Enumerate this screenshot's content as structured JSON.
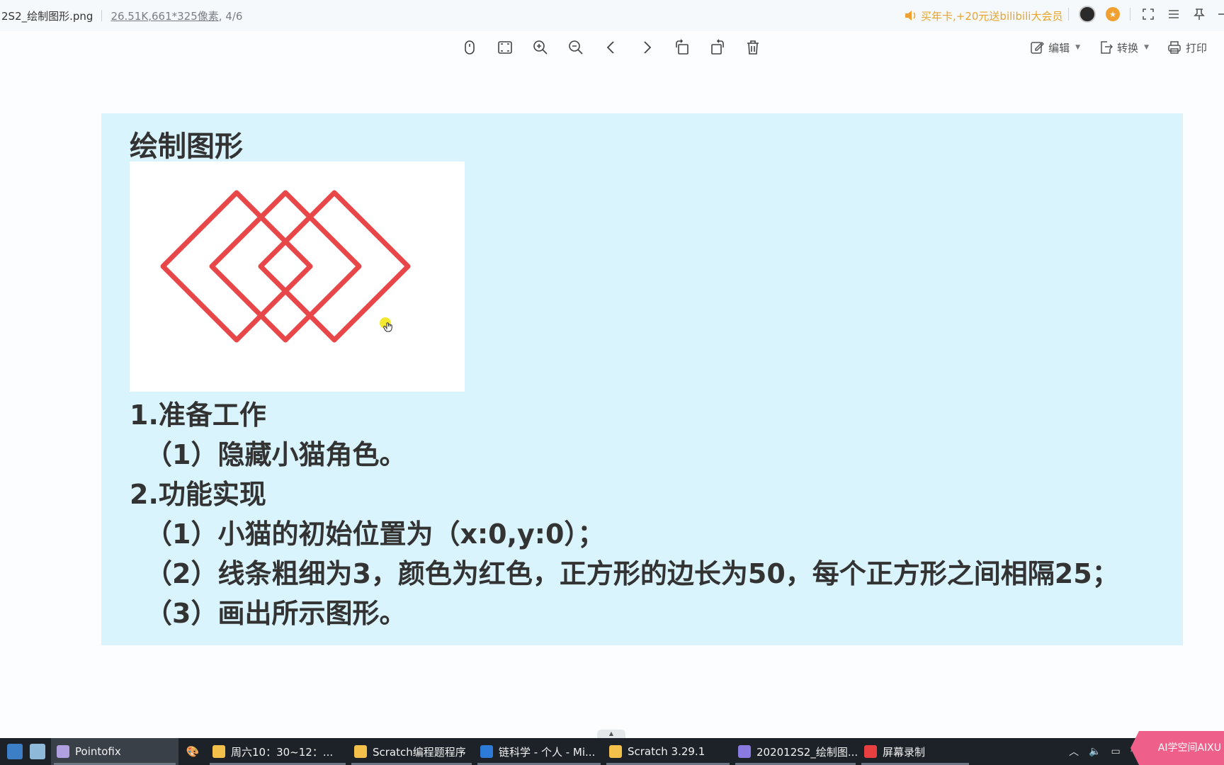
{
  "titlebar": {
    "filename": "2S2_绘制图形.png",
    "filesize": "26.51K",
    "dimensions": ",661*325像素",
    "page_index": ", 4/6",
    "promo": "买年卡,+20元送bilibili大会员"
  },
  "toolbar": {
    "tools": [
      "mouse-icon",
      "fit-screen-icon",
      "zoom-in-icon",
      "zoom-out-icon",
      "previous-icon",
      "next-icon",
      "rotate-left-icon",
      "rotate-right-icon",
      "delete-icon"
    ],
    "edit_label": "编辑",
    "convert_label": "转换",
    "print_label": "打印"
  },
  "document": {
    "title": "绘制图形",
    "lines": [
      {
        "text": "1.准备工作",
        "indent": false
      },
      {
        "text": "（1）隐藏小猫角色。",
        "indent": true
      },
      {
        "text": "2.功能实现",
        "indent": false
      },
      {
        "text": "（1）小猫的初始位置为（x:0,y:0）；",
        "indent": true
      },
      {
        "text": "（2）线条粗细为3，颜色为红色，正方形的边长为50，每个正方形之间相隔25；",
        "indent": true
      },
      {
        "text": "（3）画出所示图形。",
        "indent": true
      }
    ],
    "figure": {
      "shape_count": 3,
      "stroke_color": "#e8474a",
      "side_length": 50,
      "spacing": 25
    },
    "background_color": "#d9f4fc"
  },
  "taskbar": {
    "items": [
      {
        "label": "Pointofix",
        "active": true
      },
      {
        "label": "周六10：30~12：...",
        "active": false
      },
      {
        "label": "Scratch编程题程序",
        "active": false
      },
      {
        "label": "链科学 - 个人 - Mi...",
        "active": false
      },
      {
        "label": "Scratch 3.29.1",
        "active": false
      },
      {
        "label": "202012S2_绘制图...",
        "active": false
      },
      {
        "label": "屏幕录制",
        "active": false
      }
    ],
    "ribbon": "AI学空间AIXU"
  }
}
